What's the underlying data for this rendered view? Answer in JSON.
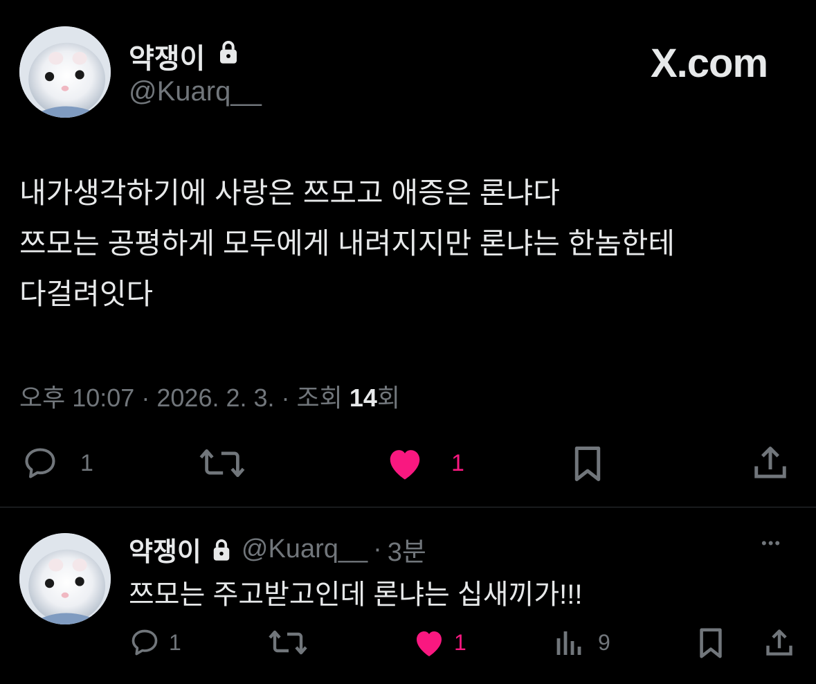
{
  "main_tweet": {
    "display_name": "약쟁이",
    "handle": "@Kuarq__",
    "text": "내가생각하기에 사랑은 쯔모고 애증은 론냐다\n쯔모는 공평하게 모두에게 내려지지만 론냐는 한놈한테\n다걸려잇다",
    "meta": {
      "time": "오후 10:07",
      "separator": "·",
      "date": "2026. 2. 3.",
      "views_label": "조회",
      "views_count": "14",
      "views_suffix": "회"
    },
    "actions": {
      "reply_count": "1",
      "like_count": "1"
    }
  },
  "brand": {
    "logo_text": "X.com"
  },
  "reply_tweet": {
    "display_name": "약쟁이",
    "handle": "@Kuarq__",
    "separator": "·",
    "time_ago": "3분",
    "text": "쯔모는 주고받고인데 론냐는 십새끼가!!!",
    "more_label": "•••",
    "actions": {
      "reply_count": "1",
      "like_count": "1",
      "views_count": "9"
    }
  },
  "colors": {
    "background": "#000000",
    "text_primary": "#e7e9ea",
    "text_muted": "#71767b",
    "like": "#f91880",
    "divider": "#2f3336"
  },
  "icons": [
    "lock-icon",
    "reply-icon",
    "retweet-icon",
    "heart-icon",
    "bookmark-icon",
    "share-icon",
    "views-icon",
    "more-icon"
  ]
}
